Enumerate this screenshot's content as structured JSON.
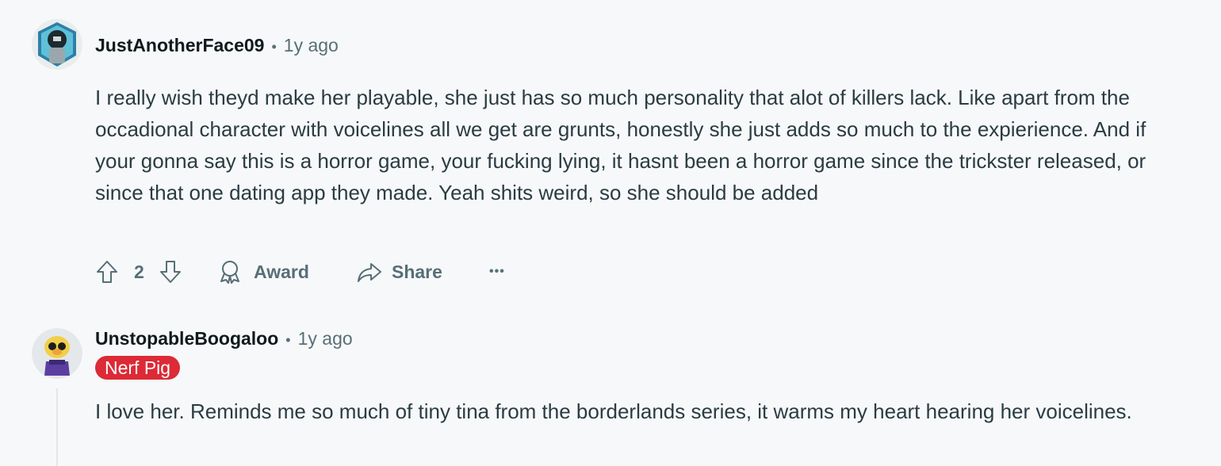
{
  "comments": [
    {
      "username": "JustAnotherFace09",
      "separator": "•",
      "time": "1y ago",
      "body": "I really wish theyd make her playable, she just has so much personality that alot of killers lack. Like apart from the occadional character with voicelines all we get are grunts, honestly she just adds so much to the expierience. And if your gonna say this is a horror game, your fucking lying, it hasnt been a horror game since the trickster released, or since that one dating app they made. Yeah shits weird, so she should be added",
      "votes": "2",
      "award_label": "Award",
      "share_label": "Share",
      "more_label": "•••"
    },
    {
      "username": "UnstopableBoogaloo",
      "separator": "•",
      "time": "1y ago",
      "flair": "Nerf Pig",
      "body": "I love her. Reminds me so much of tiny tina from the borderlands series, it warms my heart hearing her voicelines."
    }
  ],
  "colors": {
    "background": "#f7f8fa",
    "meta_text": "#576f76",
    "flair_bg": "#dc2a36"
  },
  "icons": [
    "upvote-icon",
    "downvote-icon",
    "award-icon",
    "share-icon",
    "more-icon"
  ]
}
